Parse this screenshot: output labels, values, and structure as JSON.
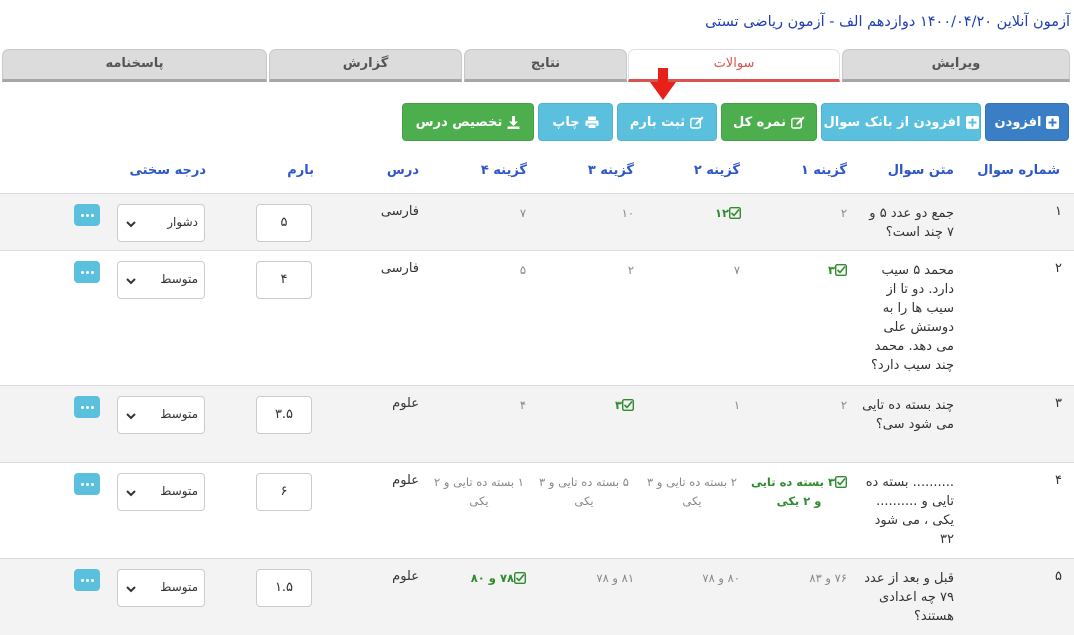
{
  "page_title": "آزمون آنلاین ۱۴۰۰/۰۴/۲۰ دوازدهم الف - آزمون ریاضی تستی",
  "tabs": [
    {
      "label": "ویرایش",
      "active": false
    },
    {
      "label": "سوالات",
      "active": true
    },
    {
      "label": "نتایج",
      "active": false
    },
    {
      "label": "گزارش",
      "active": false
    },
    {
      "label": "پاسخنامه",
      "active": false
    }
  ],
  "toolbar": {
    "add": "افزودن",
    "add_from_bank": "افزودن از بانک سوال",
    "total_score": "نمره کل",
    "set_score": "ثبت بارم",
    "print": "چاپ",
    "assign_course": "تخصیص درس"
  },
  "columns": {
    "number": "شماره سوال",
    "text": "متن سوال",
    "opt1": "گزینه ۱",
    "opt2": "گزینه ۲",
    "opt3": "گزینه ۳",
    "opt4": "گزینه ۴",
    "course": "درس",
    "score": "بارم",
    "difficulty": "درجه سختی"
  },
  "rows": [
    {
      "num": "۱",
      "text": "جمع دو عدد ۵ و ۷ چند است؟",
      "opt1": "۲",
      "opt2": "۱۲",
      "opt3": "۱۰",
      "opt4": "۷",
      "correct": 2,
      "course": "فارسی",
      "score": "۵",
      "difficulty": "دشوار"
    },
    {
      "num": "۲",
      "text": "محمد ۵ سیب دارد. دو تا از سیب ها را به دوستش علی می دهد. محمد چند سیب دارد؟",
      "opt1": "۳",
      "opt2": "۷",
      "opt3": "۲",
      "opt4": "۵",
      "correct": 1,
      "course": "فارسی",
      "score": "۴",
      "difficulty": "متوسط"
    },
    {
      "num": "۳",
      "text": "چند بسته ده تایی می شود سی؟",
      "opt1": "۲",
      "opt2": "۱",
      "opt3": "۳",
      "opt4": "۴",
      "correct": 3,
      "course": "علوم",
      "score": "۳.۵",
      "difficulty": "متوسط"
    },
    {
      "num": "۴",
      "text": ".......... بسته ده تایی و .......... یکی ، می شود ۳۲",
      "opt1": "۳ بسته ده تایی و ۲ یکی",
      "opt2": "۲ بسته ده تایی و ۳ یکی",
      "opt3": "۵ بسته ده تایی و ۳ یکی",
      "opt4": "۱ بسته ده تایی و ۲ یکی",
      "correct": 1,
      "course": "علوم",
      "score": "۶",
      "difficulty": "متوسط"
    },
    {
      "num": "۵",
      "text": "قبل و بعد از عدد ۷۹ چه اعدادی هستند؟",
      "opt1": "۷۶ و ۸۳",
      "opt2": "۸۰ و ۷۸",
      "opt3": "۸۱ و ۷۸",
      "opt4": "۷۸ و ۸۰",
      "correct": 4,
      "course": "علوم",
      "score": "۱.۵",
      "difficulty": "متوسط"
    }
  ],
  "colors": {
    "primary": "#3a7fc5",
    "info": "#5bc0de",
    "success": "#4cae4c",
    "danger": "#d9534f",
    "header_text": "#2c56c9",
    "title_text": "#1f3fb0"
  }
}
